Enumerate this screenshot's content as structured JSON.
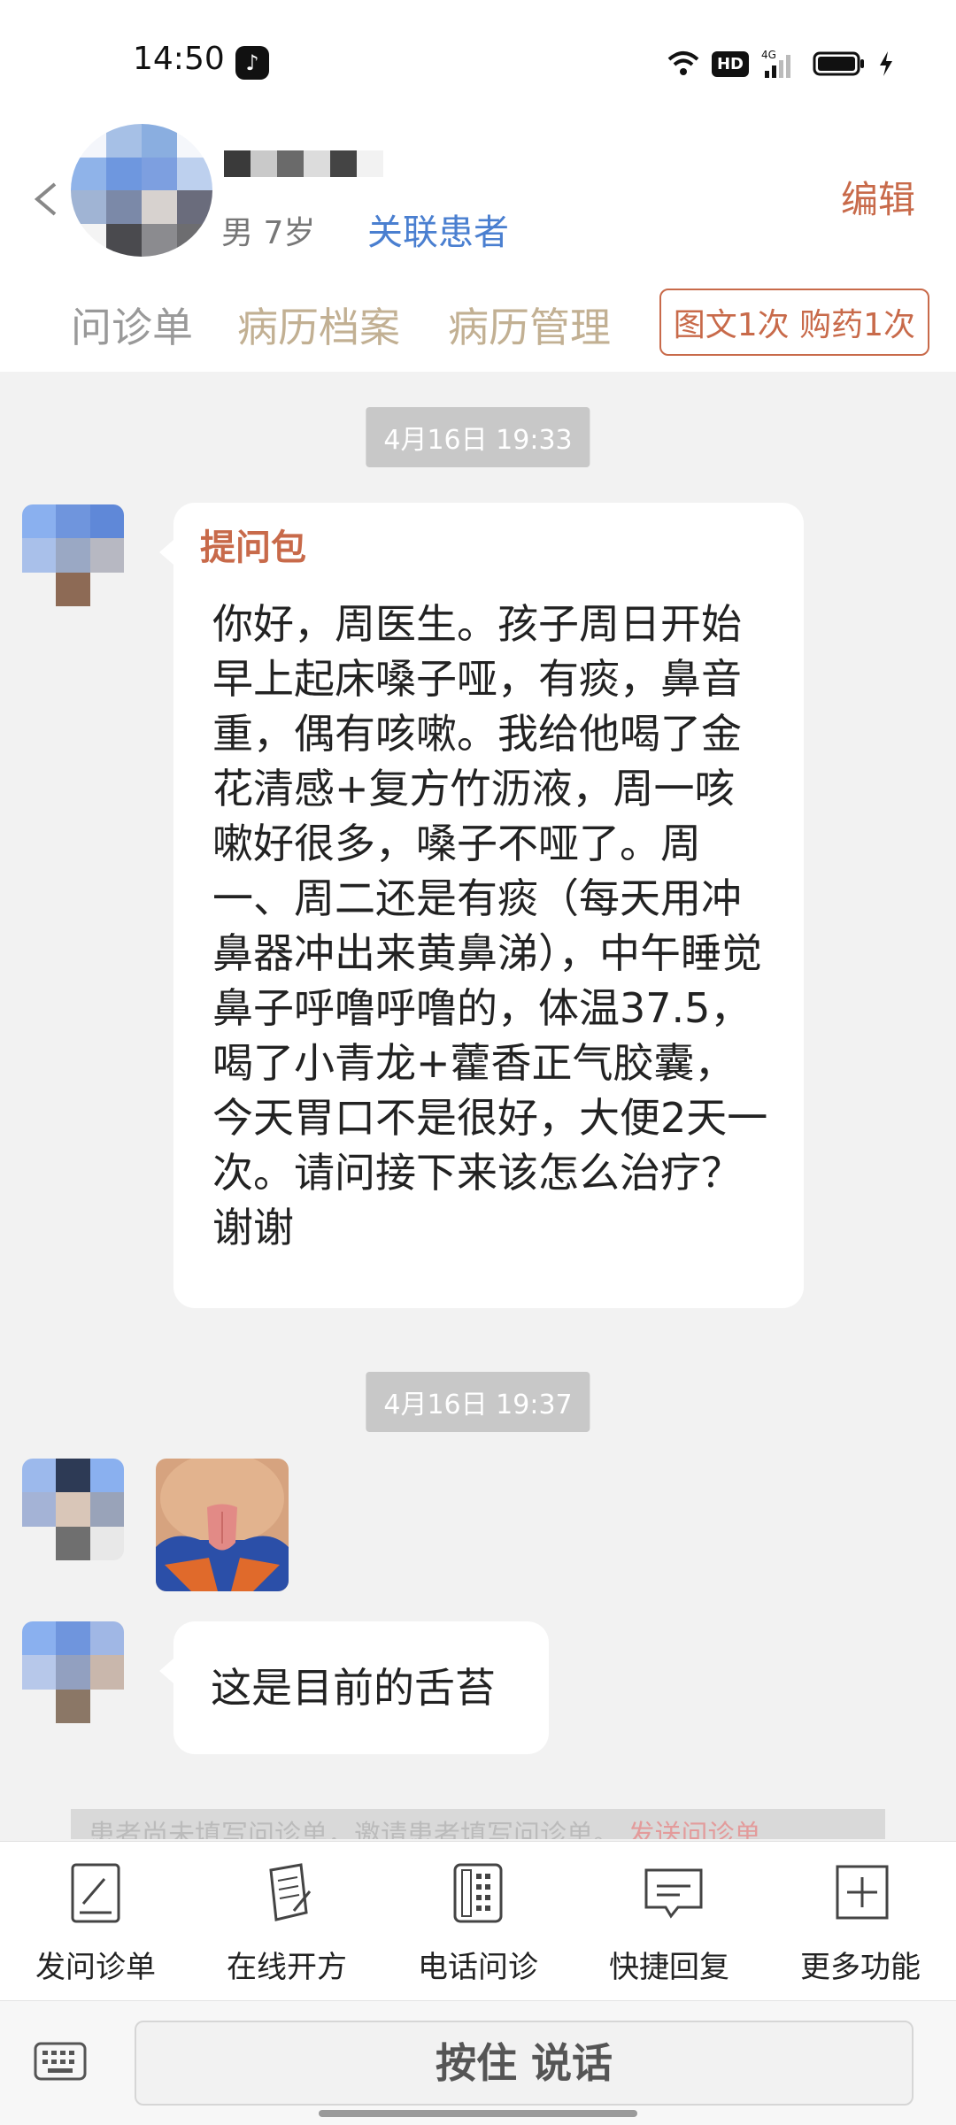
{
  "status": {
    "time": "14:50",
    "hd": "HD",
    "network": "4G"
  },
  "header": {
    "gender_age": "男 7岁",
    "link_patient": "关联患者",
    "edit": "编辑",
    "tabs": [
      "问诊单",
      "病历档案",
      "病历管理"
    ],
    "counts": "图文1次 购药1次"
  },
  "chat": {
    "timestamp_1": "4月16日 19:33",
    "bundle_title": "提问包",
    "message_1": "你好，周医生。孩子周日开始早上起床嗓子哑，有痰，鼻音重，偶有咳嗽。我给他喝了金花清感+复方竹沥液，周一咳嗽好很多，嗓子不哑了。周一、周二还是有痰（每天用冲鼻器冲出来黄鼻涕），中午睡觉鼻子呼噜呼噜的，体温37.5，喝了小青龙+藿香正气胶囊，今天胃口不是很好，大便2天一次。请问接下来该怎么治疗？谢谢",
    "timestamp_2": "4月16日 19:37",
    "message_2": "这是目前的舌苔"
  },
  "notice": {
    "text": "患者尚未填写问诊单，邀请患者填写问诊单。",
    "link": "发送问诊单"
  },
  "toolbar": {
    "items": [
      {
        "label": "发问诊单",
        "icon": "form-edit-icon"
      },
      {
        "label": "在线开方",
        "icon": "prescription-icon"
      },
      {
        "label": "电话问诊",
        "icon": "phone-icon"
      },
      {
        "label": "快捷回复",
        "icon": "quick-reply-icon"
      },
      {
        "label": "更多功能",
        "icon": "more-plus-icon"
      }
    ]
  },
  "input": {
    "hold_to_talk": "按住 说话"
  },
  "colors": {
    "accent": "#c86a4a",
    "link": "#4a7fd0",
    "tab": "#c2b093"
  }
}
